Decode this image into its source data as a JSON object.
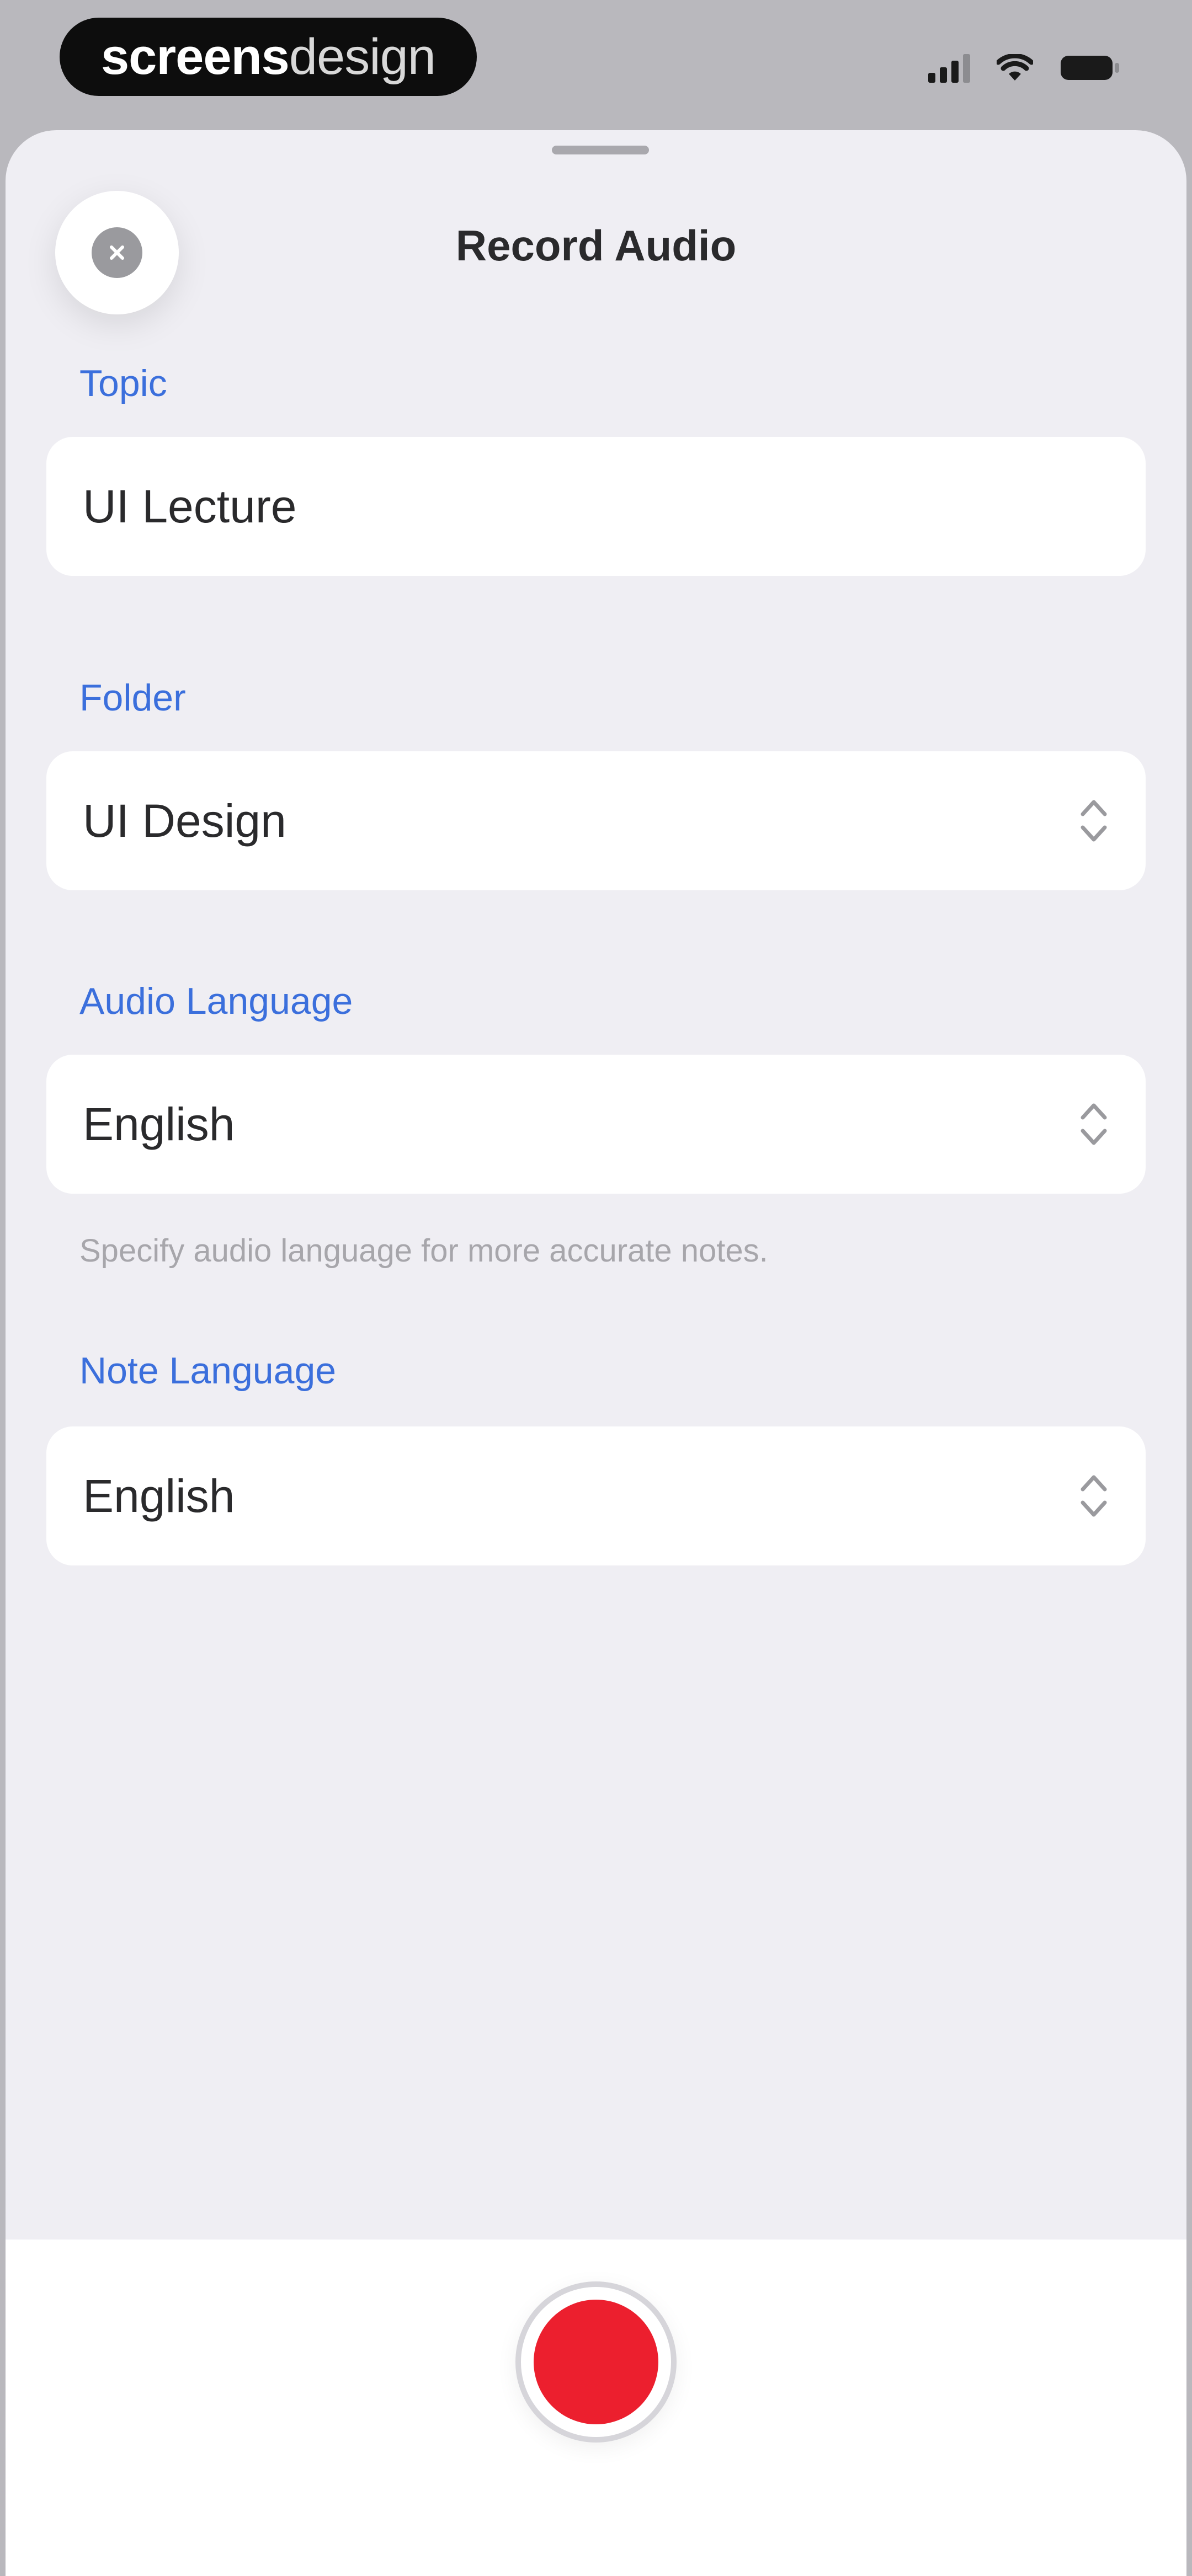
{
  "status_bar": {
    "brand_bold": "screens",
    "brand_light": "design"
  },
  "sheet": {
    "title": "Record Audio"
  },
  "topic": {
    "label": "Topic",
    "value": "UI Lecture"
  },
  "folder": {
    "label": "Folder",
    "value": "UI Design"
  },
  "audio_language": {
    "label": "Audio Language",
    "value": "English",
    "helper": "Specify audio language for more accurate notes."
  },
  "note_language": {
    "label": "Note Language",
    "value": "English"
  },
  "colors": {
    "accent": "#3b6fdc",
    "record": "#ec1f2e",
    "sheet_background": "#efeef3"
  },
  "icons": {
    "close": "close-icon",
    "picker": "chevron-updown-icon",
    "record": "record-icon"
  }
}
